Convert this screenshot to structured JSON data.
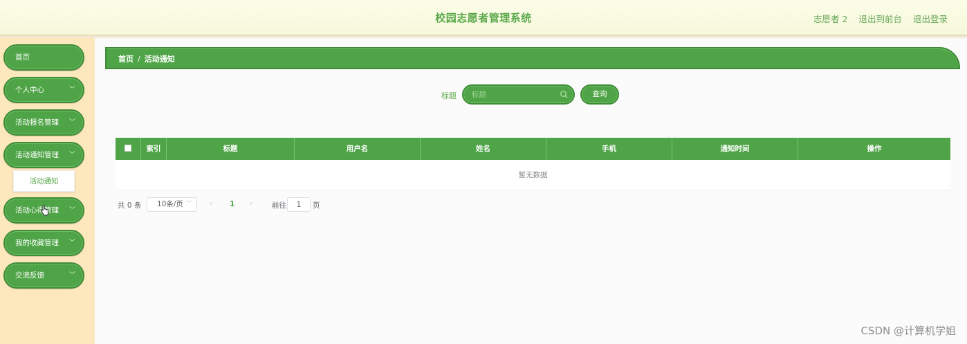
{
  "header": {
    "title": "校园志愿者管理系统",
    "user": "志愿者 2",
    "front_link": "退出到前台",
    "logout_link": "退出登录"
  },
  "sidebar": {
    "items": [
      {
        "label": "首页"
      },
      {
        "label": "个人中心",
        "chevron": "﹀"
      },
      {
        "label": "活动报名管理",
        "chevron": "﹀"
      },
      {
        "label": "活动通知管理",
        "chevron": "﹀"
      },
      {
        "label": "活动心得管理",
        "chevron": "﹀"
      },
      {
        "label": "我的收藏管理",
        "chevron": "﹀"
      },
      {
        "label": "交流反馈",
        "chevron": "﹀"
      }
    ],
    "submenu_item": "活动通知"
  },
  "breadcrumb": {
    "home": "首页",
    "separator": "/",
    "current": "活动通知"
  },
  "search": {
    "label": "标题",
    "placeholder": "标题",
    "button": "查询"
  },
  "table": {
    "columns": [
      "索引",
      "标题",
      "用户名",
      "姓名",
      "手机",
      "通知时间",
      "操作"
    ],
    "empty_text": "暂无数据"
  },
  "pagination": {
    "total": "共 0 条",
    "page_size": "10条/页",
    "prev": "‹",
    "current_page": "1",
    "next": "›",
    "goto_label": "前往",
    "goto_value": "1",
    "goto_suffix": "页"
  },
  "watermark": "CSDN @计算机学姐",
  "colors": {
    "accent": "#4fa447",
    "accent_border": "#3f8a37",
    "sidebar_bg": "#fde7bd",
    "header_bg": "#f6f8dc"
  }
}
